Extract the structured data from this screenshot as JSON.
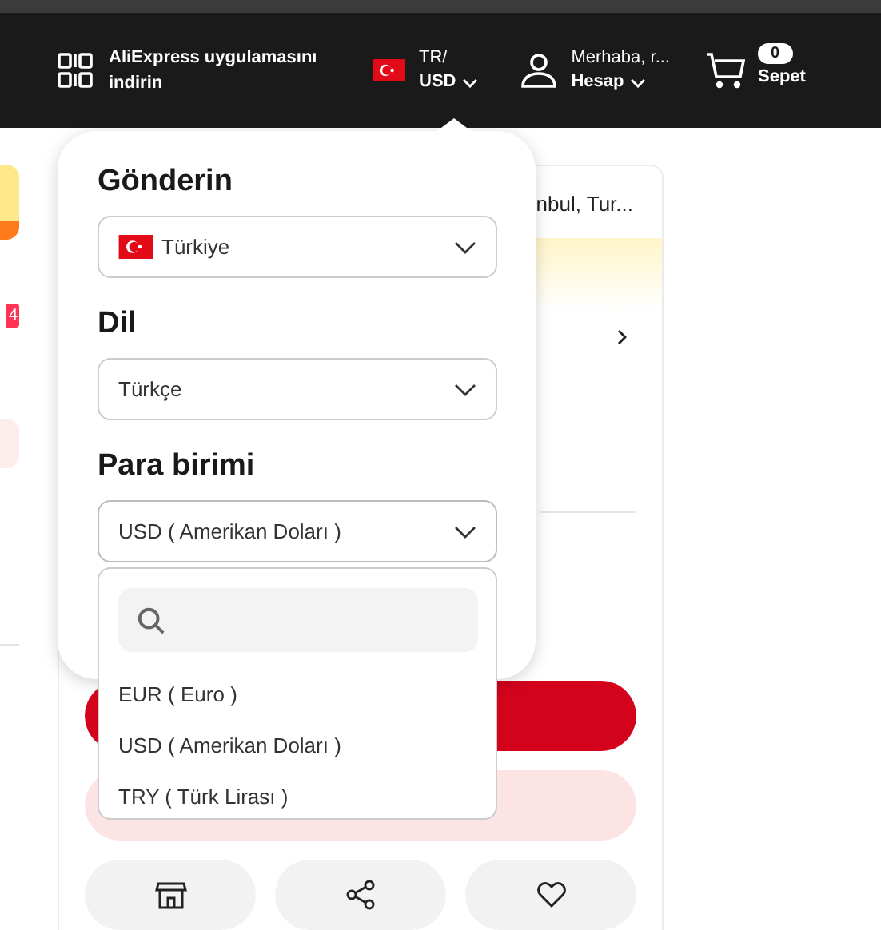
{
  "header": {
    "app_promo": "AliExpress uygulamasını indirin",
    "region": {
      "country": "TR/",
      "currency": "USD"
    },
    "account": {
      "greeting": "Merhaba, r...",
      "label": "Hesap"
    },
    "cart": {
      "count": "0",
      "label": "Sepet"
    }
  },
  "page": {
    "address": "nbul, Tur...",
    "badge": "4"
  },
  "settings_popover": {
    "sections": [
      {
        "title": "Gönderin",
        "value": "Türkiye",
        "kind": "country",
        "expanded": false
      },
      {
        "title": "Dil",
        "value": "Türkçe",
        "kind": "plain",
        "expanded": false
      },
      {
        "title": "Para birimi",
        "value": "USD ( Amerikan Doları )",
        "kind": "plain",
        "expanded": true,
        "options": [
          "EUR ( Euro )",
          "USD ( Amerikan Doları )",
          "TRY ( Türk Lirası )"
        ]
      }
    ]
  }
}
